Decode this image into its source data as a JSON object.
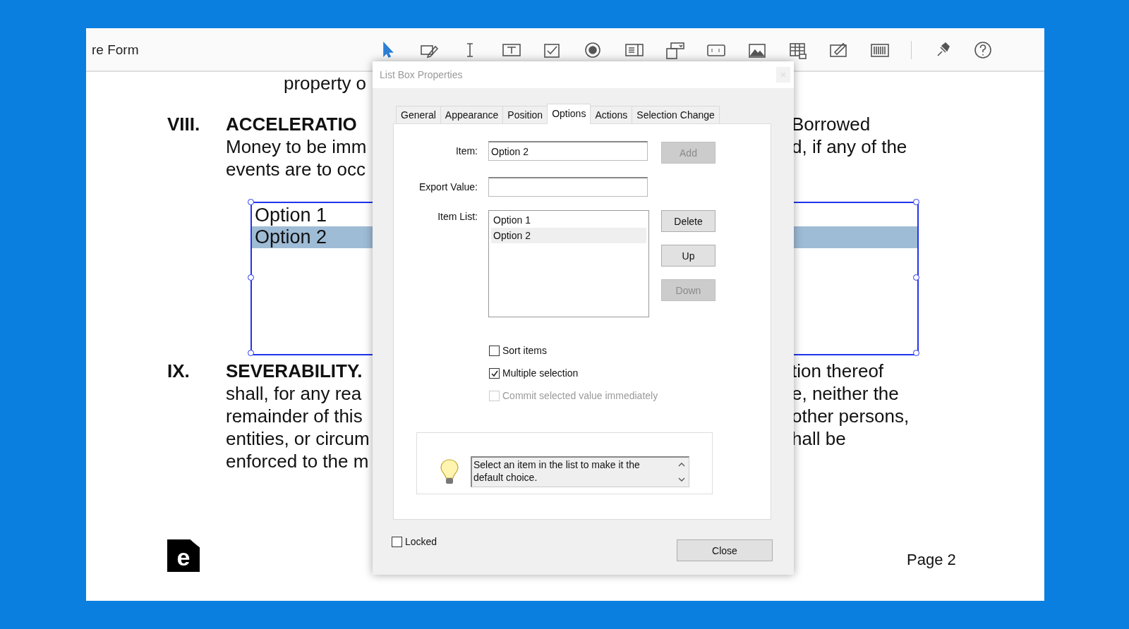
{
  "toolbar": {
    "title": "re Form"
  },
  "document": {
    "blocks": [
      {
        "kind": "text",
        "left": "property o"
      },
      {
        "kind": "section",
        "number": "VIII.",
        "lines": [
          {
            "left": "ACCELERATIO",
            "right": "Borrowed"
          },
          {
            "left": "Money to be imm",
            "right": "d, if any of the"
          },
          {
            "left": "events are to occ"
          }
        ]
      },
      {
        "kind": "list_box",
        "options": [
          {
            "label": "Option 1",
            "selected": false
          },
          {
            "label": "Option 2",
            "selected": true
          }
        ]
      },
      {
        "kind": "section",
        "number": "IX.",
        "lines": [
          {
            "left": "SEVERABILITY.",
            "right": "tion thereof"
          },
          {
            "left": "shall, for any rea",
            "right": "e, neither the"
          },
          {
            "left": "remainder of this",
            "right": "other persons,"
          },
          {
            "left": "entities, or circum",
            "right": "hall be"
          },
          {
            "left": "enforced to the m"
          }
        ]
      }
    ],
    "logo": "e",
    "page_label": "Page 2"
  },
  "dialog": {
    "title": "List Box Properties",
    "tabs": [
      {
        "label": "General",
        "selected": false
      },
      {
        "label": "Appearance",
        "selected": false
      },
      {
        "label": "Position",
        "selected": false
      },
      {
        "label": "Options",
        "selected": true
      },
      {
        "label": "Actions",
        "selected": false
      },
      {
        "label": "Selection Change",
        "selected": false
      }
    ],
    "item": {
      "label": "Item:",
      "value": "Option 2"
    },
    "add_button": {
      "label": "Add",
      "disabled": true
    },
    "export_value": {
      "label": "Export Value:"
    },
    "item_list": {
      "label": "Item List:",
      "items": [
        {
          "label": "Option 1",
          "selected": false
        },
        {
          "label": "Option 2",
          "selected": true
        }
      ]
    },
    "list_buttons": [
      {
        "label": "Delete",
        "disabled": false
      },
      {
        "label": "Up",
        "disabled": false
      },
      {
        "label": "Down",
        "disabled": true
      }
    ],
    "checkboxes": [
      {
        "label": "Sort items",
        "checked": false,
        "disabled": false
      },
      {
        "label": "Multiple selection",
        "checked": true,
        "disabled": false
      },
      {
        "label": "Commit selected value immediately",
        "checked": false,
        "disabled": true
      }
    ],
    "hint": "Select an item in the list to make it the default choice.",
    "locked": {
      "label": "Locked",
      "checked": false
    },
    "close_button": "Close"
  }
}
